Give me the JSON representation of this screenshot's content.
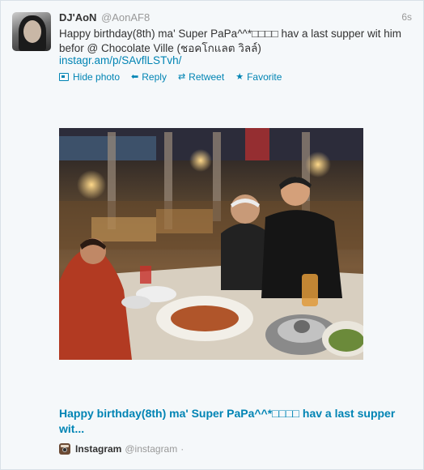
{
  "tweet": {
    "fullname": "DJ'AoN",
    "screen_name": "@AonAF8",
    "time": "6s",
    "text": "Happy birthday(8th) ma' Super PaPa^^*□□□□ hav a last supper wit him befor @ Chocolate Ville (ชอคโกแลต วิลล์)",
    "link": "instagr.am/p/SAvflLSTvh/"
  },
  "actions": {
    "hide_photo": "Hide photo",
    "reply": "Reply",
    "retweet": "Retweet",
    "favorite": "Favorite"
  },
  "card": {
    "title": "Happy birthday(8th) ma' Super PaPa^^*□□□□ hav a last supper wit...",
    "source_name": "Instagram",
    "source_handle": "@instagram",
    "source_dot": "·"
  },
  "colors": {
    "link": "#0084b4",
    "background": "#f5f8fa"
  },
  "icons": {
    "hide_photo": "photo-icon",
    "reply": "reply-arrow-icon",
    "retweet": "retweet-icon",
    "favorite": "star-icon"
  }
}
